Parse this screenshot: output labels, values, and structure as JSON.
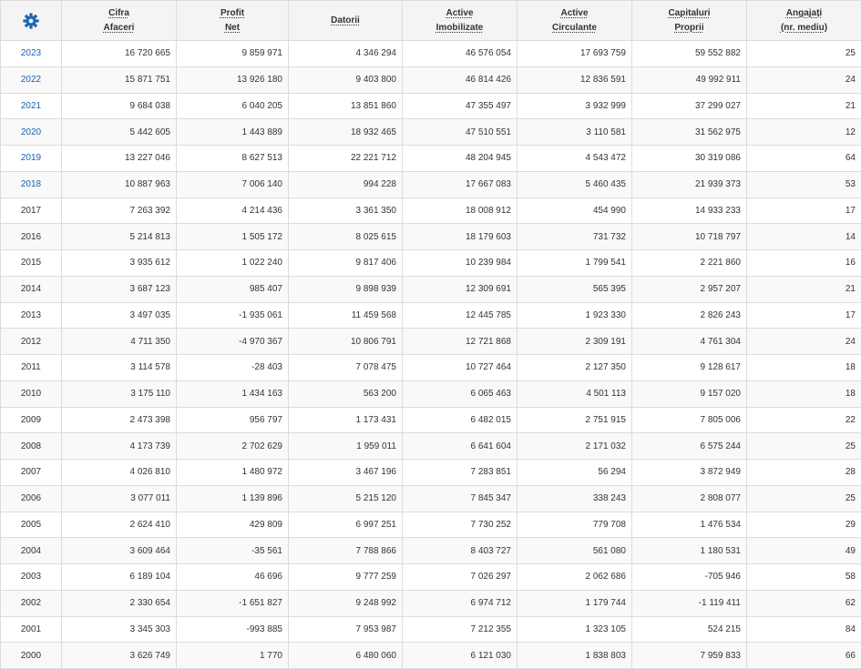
{
  "colors": {
    "link": "#1a5fb4",
    "gear": "#1f66b5",
    "border": "#dcdcdc",
    "header_bg": "#f4f4f4"
  },
  "settings_icon": "gear-icon",
  "columns": [
    {
      "line1": "Cifra",
      "line2": "Afaceri"
    },
    {
      "line1": "Profit",
      "line2": "Net"
    },
    {
      "line1": "Datorii",
      "line2": ""
    },
    {
      "line1": "Active",
      "line2": "Imobilizate"
    },
    {
      "line1": "Active",
      "line2": "Circulante"
    },
    {
      "line1": "Capitaluri",
      "line2": "Proprii"
    },
    {
      "line1": "Angajați",
      "line2": "(nr. mediu)"
    }
  ],
  "rows": [
    {
      "year": "2023",
      "link": true,
      "values": [
        "16 720 665",
        "9 859 971",
        "4 346 294",
        "46 576 054",
        "17 693 759",
        "59 552 882",
        "25"
      ]
    },
    {
      "year": "2022",
      "link": true,
      "values": [
        "15 871 751",
        "13 926 180",
        "9 403 800",
        "46 814 426",
        "12 836 591",
        "49 992 911",
        "24"
      ]
    },
    {
      "year": "2021",
      "link": true,
      "values": [
        "9 684 038",
        "6 040 205",
        "13 851 860",
        "47 355 497",
        "3 932 999",
        "37 299 027",
        "21"
      ]
    },
    {
      "year": "2020",
      "link": true,
      "values": [
        "5 442 605",
        "1 443 889",
        "18 932 465",
        "47 510 551",
        "3 110 581",
        "31 562 975",
        "12"
      ]
    },
    {
      "year": "2019",
      "link": true,
      "values": [
        "13 227 046",
        "8 627 513",
        "22 221 712",
        "48 204 945",
        "4 543 472",
        "30 319 086",
        "64"
      ]
    },
    {
      "year": "2018",
      "link": true,
      "values": [
        "10 887 963",
        "7 006 140",
        "994 228",
        "17 667 083",
        "5 460 435",
        "21 939 373",
        "53"
      ]
    },
    {
      "year": "2017",
      "link": false,
      "values": [
        "7 263 392",
        "4 214 436",
        "3 361 350",
        "18 008 912",
        "454 990",
        "14 933 233",
        "17"
      ]
    },
    {
      "year": "2016",
      "link": false,
      "values": [
        "5 214 813",
        "1 505 172",
        "8 025 615",
        "18 179 603",
        "731 732",
        "10 718 797",
        "14"
      ]
    },
    {
      "year": "2015",
      "link": false,
      "values": [
        "3 935 612",
        "1 022 240",
        "9 817 406",
        "10 239 984",
        "1 799 541",
        "2 221 860",
        "16"
      ]
    },
    {
      "year": "2014",
      "link": false,
      "values": [
        "3 687 123",
        "985 407",
        "9 898 939",
        "12 309 691",
        "565 395",
        "2 957 207",
        "21"
      ]
    },
    {
      "year": "2013",
      "link": false,
      "values": [
        "3 497 035",
        "-1 935 061",
        "11 459 568",
        "12 445 785",
        "1 923 330",
        "2 826 243",
        "17"
      ]
    },
    {
      "year": "2012",
      "link": false,
      "values": [
        "4 711 350",
        "-4 970 367",
        "10 806 791",
        "12 721 868",
        "2 309 191",
        "4 761 304",
        "24"
      ]
    },
    {
      "year": "2011",
      "link": false,
      "values": [
        "3 114 578",
        "-28 403",
        "7 078 475",
        "10 727 464",
        "2 127 350",
        "9 128 617",
        "18"
      ]
    },
    {
      "year": "2010",
      "link": false,
      "values": [
        "3 175 110",
        "1 434 163",
        "563 200",
        "6 065 463",
        "4 501 113",
        "9 157 020",
        "18"
      ]
    },
    {
      "year": "2009",
      "link": false,
      "values": [
        "2 473 398",
        "956 797",
        "1 173 431",
        "6 482 015",
        "2 751 915",
        "7 805 006",
        "22"
      ]
    },
    {
      "year": "2008",
      "link": false,
      "values": [
        "4 173 739",
        "2 702 629",
        "1 959 011",
        "6 641 604",
        "2 171 032",
        "6 575 244",
        "25"
      ]
    },
    {
      "year": "2007",
      "link": false,
      "values": [
        "4 026 810",
        "1 480 972",
        "3 467 196",
        "7 283 851",
        "56 294",
        "3 872 949",
        "28"
      ]
    },
    {
      "year": "2006",
      "link": false,
      "values": [
        "3 077 011",
        "1 139 896",
        "5 215 120",
        "7 845 347",
        "338 243",
        "2 808 077",
        "25"
      ]
    },
    {
      "year": "2005",
      "link": false,
      "values": [
        "2 624 410",
        "429 809",
        "6 997 251",
        "7 730 252",
        "779 708",
        "1 476 534",
        "29"
      ]
    },
    {
      "year": "2004",
      "link": false,
      "values": [
        "3 609 464",
        "-35 561",
        "7 788 866",
        "8 403 727",
        "561 080",
        "1 180 531",
        "49"
      ]
    },
    {
      "year": "2003",
      "link": false,
      "values": [
        "6 189 104",
        "46 696",
        "9 777 259",
        "7 026 297",
        "2 062 686",
        "-705 946",
        "58"
      ]
    },
    {
      "year": "2002",
      "link": false,
      "values": [
        "2 330 654",
        "-1 651 827",
        "9 248 992",
        "6 974 712",
        "1 179 744",
        "-1 119 411",
        "62"
      ]
    },
    {
      "year": "2001",
      "link": false,
      "values": [
        "3 345 303",
        "-993 885",
        "7 953 987",
        "7 212 355",
        "1 323 105",
        "524 215",
        "84"
      ]
    },
    {
      "year": "2000",
      "link": false,
      "values": [
        "3 626 749",
        "1 770",
        "6 480 060",
        "6 121 030",
        "1 838 803",
        "7 959 833",
        "66"
      ]
    }
  ]
}
